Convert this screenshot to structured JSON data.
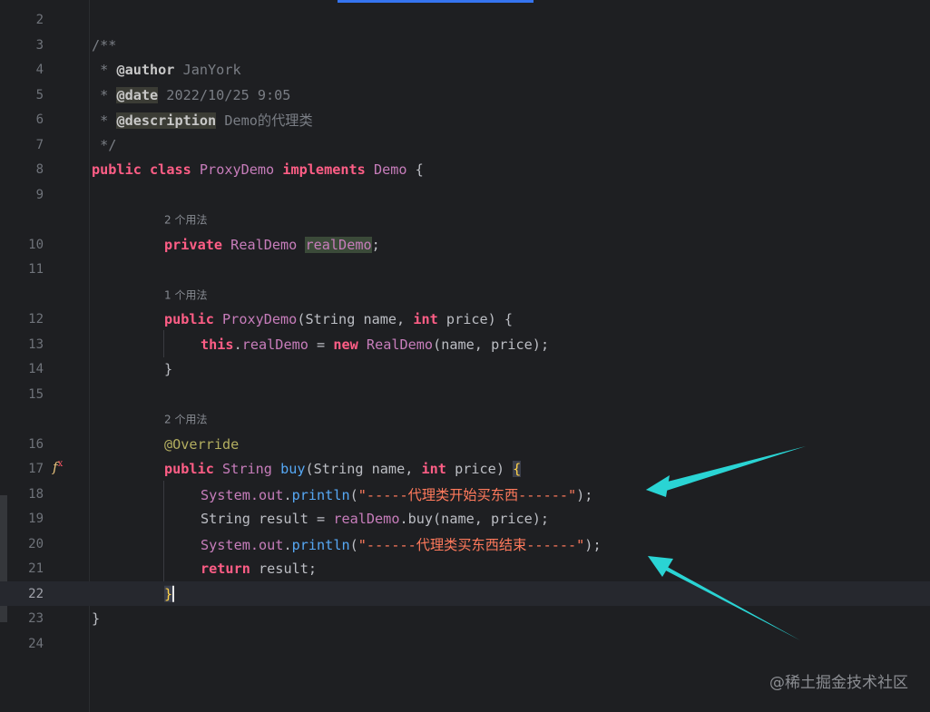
{
  "line_numbers": [
    "2",
    "3",
    "4",
    "5",
    "6",
    "7",
    "8",
    "9",
    "10",
    "11",
    "12",
    "13",
    "14",
    "15",
    "16",
    "17",
    "18",
    "19",
    "20",
    "21",
    "22",
    "23",
    "24"
  ],
  "hints": {
    "realDemo_usages": "2 个用法",
    "constructor_usages": "1 个用法",
    "buy_usages": "2 个用法"
  },
  "code": {
    "l3": "/**",
    "l4_prefix": " * ",
    "l4_tag": "@author",
    "l4_value": " JanYork",
    "l5_prefix": " * ",
    "l5_tag": "@date",
    "l5_value": " 2022/10/25 9:05",
    "l6_prefix": " * ",
    "l6_tag": "@description",
    "l6_value": " Demo的代理类",
    "l7": " */",
    "l8_kw1": "public",
    "l8_kw2": "class",
    "l8_cls": "ProxyDemo",
    "l8_kw3": "implements",
    "l8_iface": "Demo",
    "l8_brace": " {",
    "l10_kw": "private",
    "l10_type": "RealDemo",
    "l10_field": "realDemo",
    "l10_end": ";",
    "l12_kw": "public",
    "l12_ctor": "ProxyDemo",
    "l12_rest_a": "(String name, ",
    "l12_int": "int",
    "l12_rest_b": " price) {",
    "l13_this": "this",
    "l13_dot": ".",
    "l13_field": "realDemo",
    "l13_eq": " = ",
    "l13_new": "new",
    "l13_type": "RealDemo",
    "l13_args": "(name, price);",
    "l14": "}",
    "l16": "@Override",
    "l17_kw": "public",
    "l17_type": "String",
    "l17_method": "buy",
    "l17_args_a": "(String name, ",
    "l17_int": "int",
    "l17_args_b": " price) ",
    "l17_brace": "{",
    "l18_sys": "System.",
    "l18_out": "out",
    "l18_dot": ".",
    "l18_m": "println",
    "l18_open": "(",
    "l18_str": "\"-----代理类开始买东西------\"",
    "l18_close": ");",
    "l19_a": "String result = ",
    "l19_field": "realDemo",
    "l19_b": ".buy(name, price);",
    "l20_sys": "System.",
    "l20_out": "out",
    "l20_dot": ".",
    "l20_m": "println",
    "l20_open": "(",
    "l20_str": "\"------代理类买东西结束------\"",
    "l20_close": ");",
    "l21_kw": "return",
    "l21_rest": " result;",
    "l22": "}",
    "l23": "}"
  },
  "gutter_icon": "fx-override-icon",
  "gutter_icon_text": "f",
  "gutter_icon_sup": "x",
  "watermark": "@稀土掘金技术社区",
  "colors": {
    "background": "#1e1f22",
    "keyword": "#cf8e6d",
    "string": "#ff7a5c",
    "arrow": "#2ad4d4"
  }
}
